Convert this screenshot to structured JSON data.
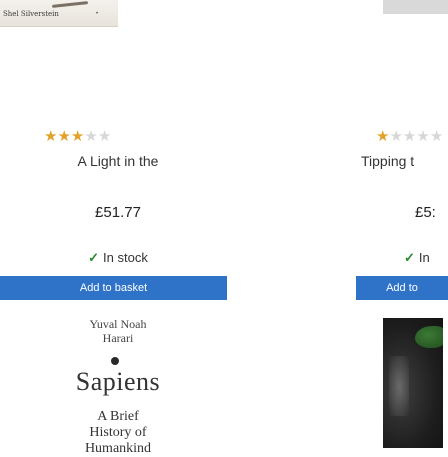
{
  "top_covers": {
    "left_tiny_text": "Shel Silverstein"
  },
  "products": [
    {
      "rating": 3,
      "max_rating": 5,
      "title": "A Light in the",
      "price": "£51.77",
      "stock": "In stock",
      "add_label": "Add to basket"
    },
    {
      "rating": 1,
      "max_rating": 5,
      "title": "Tipping t",
      "price": "£5:",
      "stock": "In",
      "add_label": "Add to"
    }
  ],
  "book_cover": {
    "author_line1": "Yuval Noah",
    "author_line2": "Harari",
    "title": "Sapiens",
    "sub1": "A Brief",
    "sub2": "History of",
    "sub3": "Humankind"
  },
  "colors": {
    "star": "#e2a22a",
    "star_empty": "#d7d7d7",
    "button": "#2e73c8",
    "stock_tick": "#2a8a2a"
  },
  "icons": {
    "stock": "check-icon",
    "rating": "star-icon"
  }
}
